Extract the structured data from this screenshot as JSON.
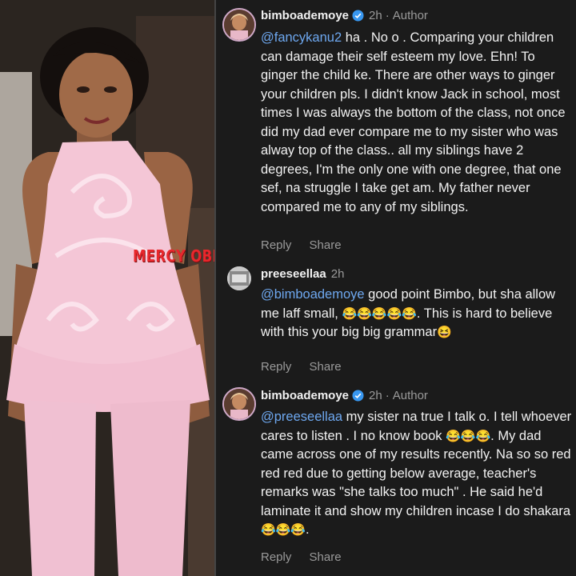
{
  "photo": {
    "watermark": "MERCY OBIDAKE BLOG"
  },
  "comments": [
    {
      "username": "bimboademoye",
      "verified": true,
      "time": "2h",
      "separator": "·",
      "badge": "Author",
      "mention": "@fancykanu2",
      "text": " ha . No o . Comparing your children can damage their self esteem my love. Ehn! To ginger the child ke. There are other ways to ginger your children pls. I didn't know Jack in school,  most times I was always the bottom of the class,  not once did my dad ever compare me to my sister who was alway top of the class.. all my siblings have 2 degrees, I'm the only one with one degree, that one sef, na struggle I take get am. My father never compared me to any of my siblings.",
      "reply": "Reply",
      "share": "Share"
    },
    {
      "username": "preeseellaa",
      "time": "2h",
      "mention": "@bimboademoye",
      "text_before": " good point Bimbo, but sha allow me laff small, ",
      "emoji_run": "😂😂😂😂😂",
      "text_after": ". This is hard to believe with this your big big grammar",
      "emoji_end": "😆",
      "reply": "Reply",
      "share": "Share"
    },
    {
      "username": "bimboademoye",
      "verified": true,
      "time": "2h",
      "separator": "·",
      "badge": "Author",
      "mention": "@preeseellaa",
      "text_before": " my sister na true I talk o. I tell whoever cares to listen . I no know book ",
      "emoji_a": "😂😂😂",
      "text_after": ". My dad came across one of my results recently. Na so so red red red due to getting below average, teacher's remarks was \"she talks too much\" . He said he'd laminate it and show my children incase I do shakara ",
      "emoji_b": "😂😂😂",
      "text_end": ".",
      "reply": "Reply",
      "share": "Share"
    }
  ],
  "colors": {
    "background": "#1b1b1b",
    "mention": "#6ea8f0",
    "meta": "#9a9a9a",
    "verified": "#3897f0",
    "watermark": "#e8272c"
  }
}
